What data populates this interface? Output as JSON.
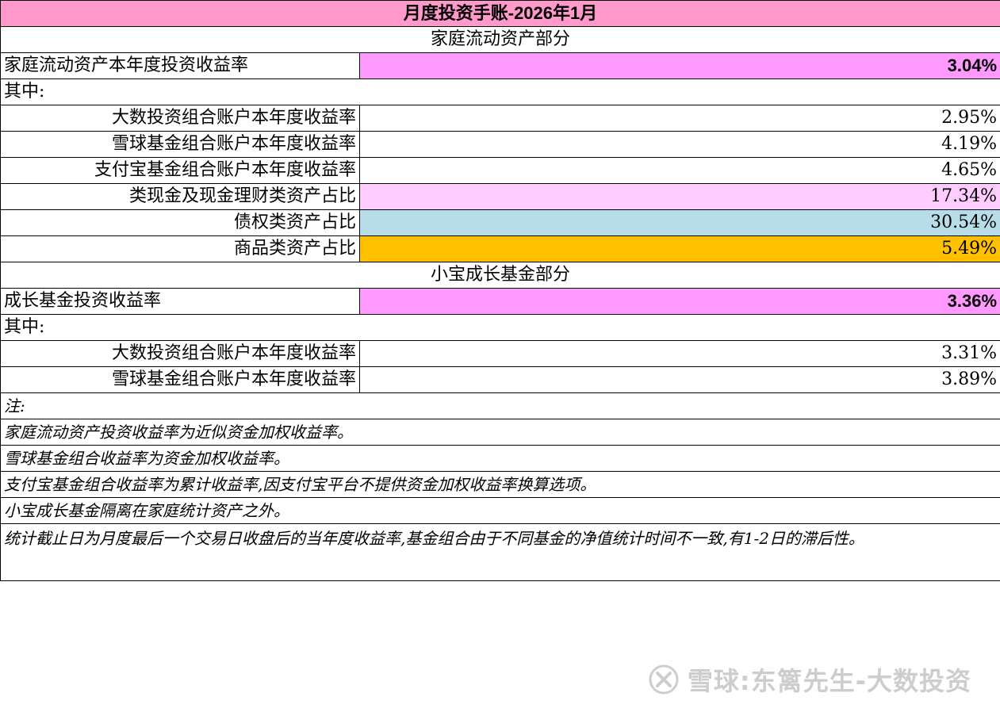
{
  "title": "月度投资手账-2026年1月",
  "family": {
    "section_label": "家庭流动资产部分",
    "total_label": "家庭流动资产本年度投资收益率",
    "total_value": "3.04%",
    "sub_label": "其中:",
    "rows": [
      {
        "label": "大数投资组合账户本年度收益率",
        "value": "2.95%"
      },
      {
        "label": "雪球基金组合账户本年度收益率",
        "value": "4.19%"
      },
      {
        "label": "支付宝基金组合账户本年度收益率",
        "value": "4.65%"
      },
      {
        "label": "类现金及现金理财类资产占比",
        "value": "17.34%"
      },
      {
        "label": "债权类资产占比",
        "value": "30.54%"
      },
      {
        "label": "商品类资产占比",
        "value": "5.49%"
      }
    ]
  },
  "growth": {
    "section_label": "小宝成长基金部分",
    "total_label": "成长基金投资收益率",
    "total_value": "3.36%",
    "sub_label": "其中:",
    "rows": [
      {
        "label": "大数投资组合账户本年度收益率",
        "value": "3.31%"
      },
      {
        "label": "雪球基金组合账户本年度收益率",
        "value": "3.89%"
      }
    ]
  },
  "notes": {
    "header": "注:",
    "items": [
      "家庭流动资产投资收益率为近似资金加权收益率。",
      "雪球基金组合收益率为资金加权收益率。",
      "支付宝基金组合收益率为累计收益率,因支付宝平台不提供资金加权收益率换算选项。",
      "小宝成长基金隔离在家庭统计资产之外。",
      "统计截止日为月度最后一个交易日收盘后的当年度收益率,基金组合由于不同基金的净值统计时间不一致,有1-2日的滞后性。"
    ]
  },
  "watermark": {
    "icon": "snowball-logo-icon",
    "text": "雪球:东篱先生-大数投资"
  },
  "colors": {
    "title_bg": "#ff99cc",
    "highlight_total": "#ff99ff",
    "cash_bg": "#ffccff",
    "bond_bg": "#b7dee8",
    "commodity_bg": "#ffc000"
  }
}
